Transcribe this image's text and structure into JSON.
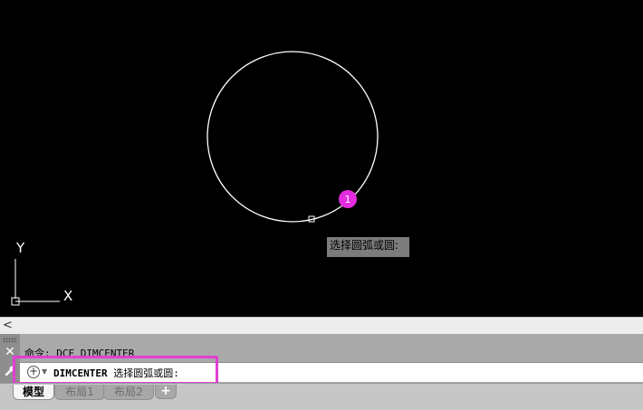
{
  "drawing": {
    "tooltip_text": "选择圆弧或圆:",
    "step_marker": "1",
    "ucs_icon": {
      "x_label": "X",
      "y_label": "Y"
    },
    "colors": {
      "background": "#000000",
      "geometry": "#ffffff",
      "marker": "#e52be0",
      "highlight": "#e040d0"
    }
  },
  "command_line": {
    "history": "命令: DCE DIMCENTER",
    "command_name": "DIMCENTER",
    "prompt_text": "选择圆弧或圆:",
    "close_icon": "close-icon",
    "settings_icon": "wrench-icon",
    "recent_commands_icon": "plus-circle-icon"
  },
  "layout_tabs": {
    "tabs": [
      {
        "label": "模型",
        "active": true
      },
      {
        "label": "布局1",
        "active": false
      },
      {
        "label": "布局2",
        "active": false
      }
    ],
    "add_label": "+"
  },
  "scroll_left_label": "<"
}
